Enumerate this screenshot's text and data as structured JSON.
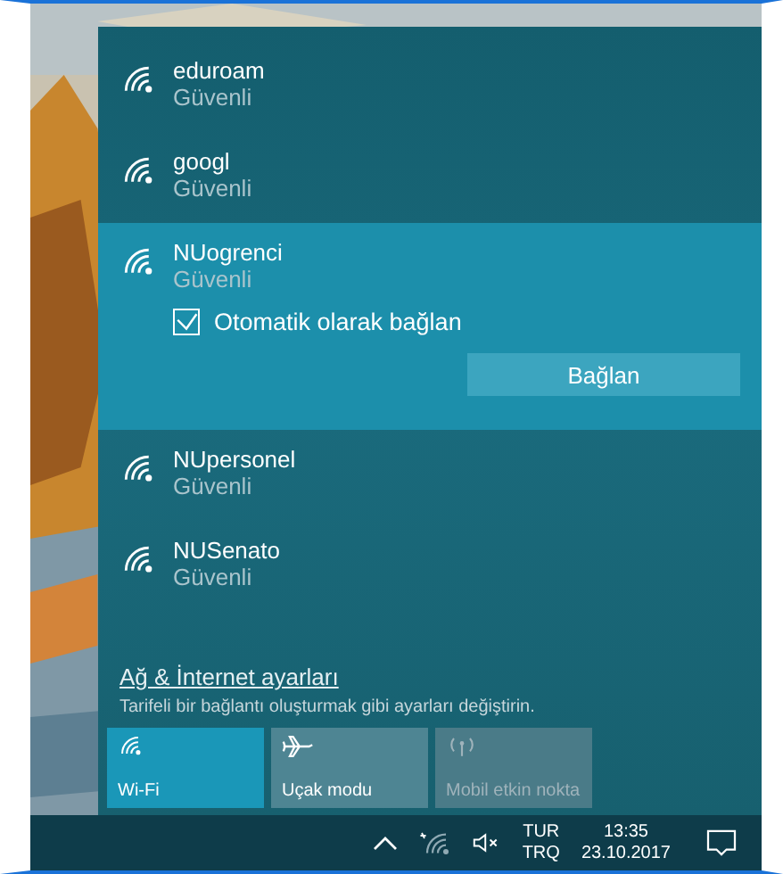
{
  "networks": [
    {
      "name": "eduroam",
      "status": "Güvenli",
      "selected": false
    },
    {
      "name": "googl",
      "status": "Güvenli",
      "selected": false
    },
    {
      "name": "NUogrenci",
      "status": "Güvenli",
      "selected": true,
      "auto_connect": {
        "label": "Otomatik olarak bağlan",
        "checked": true
      },
      "connect_button": "Bağlan"
    },
    {
      "name": "NUpersonel",
      "status": "Güvenli",
      "selected": false
    },
    {
      "name": "NUSenato",
      "status": "Güvenli",
      "selected": false
    }
  ],
  "settings_link": "Ağ & İnternet ayarları",
  "settings_hint": "Tarifeli bir bağlantı oluşturmak gibi ayarları değiştirin.",
  "quick_actions": [
    {
      "kind": "wifi",
      "label": "Wi-Fi",
      "on": true,
      "disabled": false
    },
    {
      "kind": "airplane",
      "label": "Uçak modu",
      "on": false,
      "disabled": false
    },
    {
      "kind": "hotspot",
      "label": "Mobil etkin nokta",
      "on": false,
      "disabled": true
    }
  ],
  "taskbar": {
    "language": "TUR",
    "layout": "TRQ",
    "time": "13:35",
    "date": "23.10.2017"
  }
}
